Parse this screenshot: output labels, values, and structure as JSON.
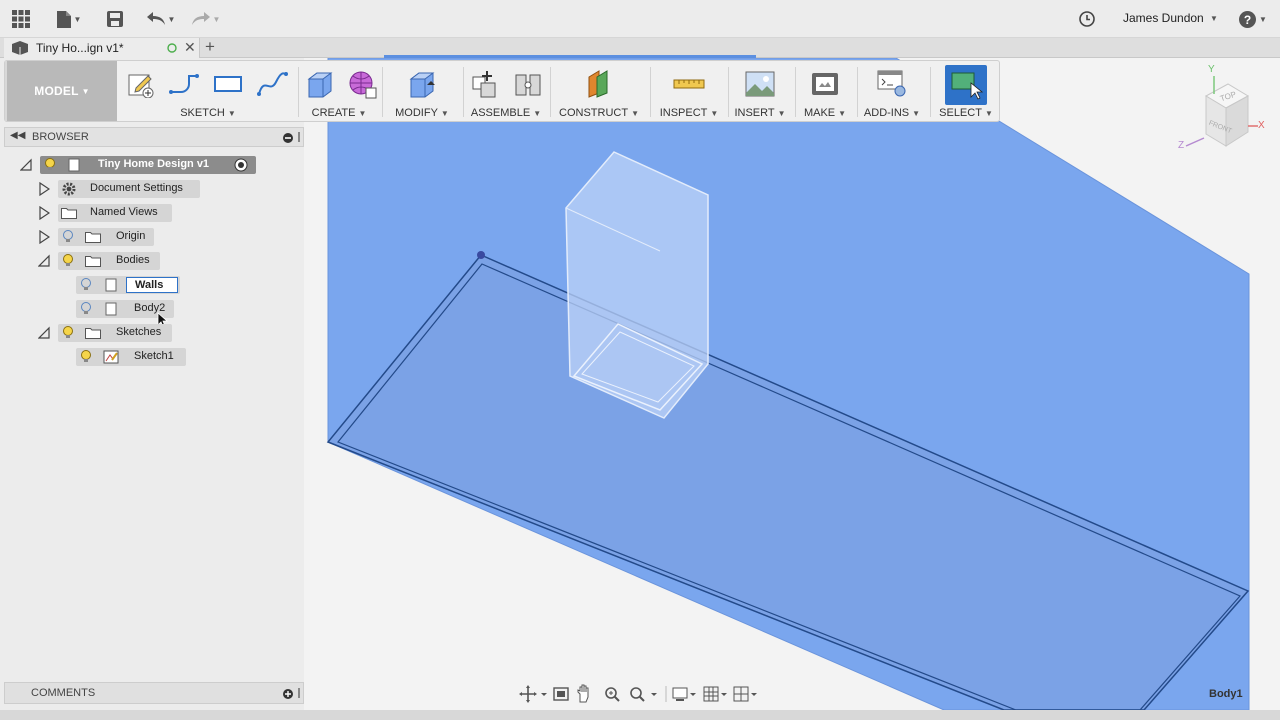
{
  "app": {
    "user_name": "James Dundon",
    "colors": {
      "accent": "#2e72c8",
      "plane_fill": "#7aa6ee",
      "model_button": "#b9b9b9"
    }
  },
  "tab": {
    "title": "Tiny Ho...ign v1*"
  },
  "toolbar": {
    "workspace": "MODEL",
    "groups": {
      "sketch": "SKETCH",
      "create": "CREATE",
      "modify": "MODIFY",
      "assemble": "ASSEMBLE",
      "construct": "CONSTRUCT",
      "inspect": "INSPECT",
      "insert": "INSERT",
      "make": "MAKE",
      "addins": "ADD-INS",
      "select": "SELECT"
    }
  },
  "browser": {
    "title": "BROWSER",
    "root": "Tiny Home Design v1",
    "items": {
      "document_settings": "Document Settings",
      "named_views": "Named Views",
      "origin": "Origin",
      "bodies": "Bodies",
      "walls": "Walls",
      "body2": "Body2",
      "sketches": "Sketches",
      "sketch1": "Sketch1"
    }
  },
  "viewcube": {
    "top": "TOP",
    "front": "FRONT",
    "axis_x": "X",
    "axis_y": "Y",
    "axis_z": "Z"
  },
  "comments": {
    "title": "COMMENTS"
  },
  "status": {
    "selected": "Body1"
  }
}
